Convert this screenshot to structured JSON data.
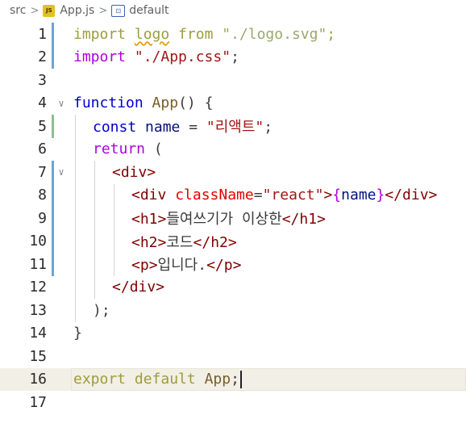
{
  "breadcrumb": {
    "folder": "src",
    "file": "App.js",
    "symbol": "default",
    "file_icon": "js-file-icon",
    "symbol_icon": "module-icon"
  },
  "editor": {
    "current_line": 16,
    "lines": [
      {
        "n": "1",
        "tokens": [
          [
            "import ",
            "faded"
          ],
          [
            "logo",
            "logo-faded squig"
          ],
          [
            " from ",
            "faded"
          ],
          [
            "\"./logo.svg\"",
            "faded-str"
          ],
          [
            ";",
            "faded"
          ]
        ],
        "mark": "#6fa3d6",
        "indent": 0
      },
      {
        "n": "2",
        "tokens": [
          [
            "import ",
            "kwc"
          ],
          [
            "\"./App.css\"",
            "str"
          ],
          [
            ";",
            "punc"
          ]
        ],
        "mark": "#6fa3d6",
        "indent": 0
      },
      {
        "n": "3",
        "tokens": [],
        "indent": 0
      },
      {
        "n": "4",
        "tokens": [
          [
            "function ",
            "kw"
          ],
          [
            "App",
            "fn"
          ],
          [
            "() {",
            "punc"
          ]
        ],
        "fold": "v",
        "indent": 0
      },
      {
        "n": "5",
        "tokens": [
          [
            "const ",
            "kw"
          ],
          [
            "name",
            "var"
          ],
          [
            " = ",
            "punc"
          ],
          [
            "\"리액트\"",
            "str"
          ],
          [
            ";",
            "punc"
          ]
        ],
        "mark": "#8dbf8d",
        "indent": 1
      },
      {
        "n": "6",
        "tokens": [
          [
            "return ",
            "kwc"
          ],
          [
            "(",
            "punc"
          ]
        ],
        "indent": 1
      },
      {
        "n": "7",
        "tokens": [
          [
            "<",
            "tag"
          ],
          [
            "div",
            "tagn"
          ],
          [
            ">",
            "tag"
          ]
        ],
        "fold": "v",
        "mark": "#6fa3d6",
        "indent": 2
      },
      {
        "n": "8",
        "tokens": [
          [
            "<",
            "tag"
          ],
          [
            "div ",
            "tagn"
          ],
          [
            "className",
            "attr"
          ],
          [
            "=",
            "punc"
          ],
          [
            "\"react\"",
            "str"
          ],
          [
            ">",
            "tag"
          ],
          [
            "{",
            "brace2"
          ],
          [
            "name",
            "var"
          ],
          [
            "}",
            "brace2"
          ],
          [
            "</",
            "tag"
          ],
          [
            "div",
            "tagn"
          ],
          [
            ">",
            "tag"
          ]
        ],
        "mark": "#6fa3d6",
        "indent": 3
      },
      {
        "n": "9",
        "tokens": [
          [
            "<",
            "tag"
          ],
          [
            "h1",
            "tagn"
          ],
          [
            ">",
            "tag"
          ],
          [
            "들여쓰기가 이상한",
            "punc"
          ],
          [
            "</",
            "tag"
          ],
          [
            "h1",
            "tagn"
          ],
          [
            ">",
            "tag"
          ]
        ],
        "mark": "#6fa3d6",
        "indent": 3
      },
      {
        "n": "10",
        "tokens": [
          [
            "<",
            "tag"
          ],
          [
            "h2",
            "tagn"
          ],
          [
            ">",
            "tag"
          ],
          [
            "코드",
            "punc"
          ],
          [
            "</",
            "tag"
          ],
          [
            "h2",
            "tagn"
          ],
          [
            ">",
            "tag"
          ]
        ],
        "mark": "#6fa3d6",
        "indent": 3
      },
      {
        "n": "11",
        "tokens": [
          [
            "<",
            "tag"
          ],
          [
            "p",
            "tagn"
          ],
          [
            ">",
            "tag"
          ],
          [
            "입니다.",
            "punc"
          ],
          [
            "</",
            "tag"
          ],
          [
            "p",
            "tagn"
          ],
          [
            ">",
            "tag"
          ]
        ],
        "mark": "#6fa3d6",
        "indent": 3
      },
      {
        "n": "12",
        "tokens": [
          [
            "</",
            "tag"
          ],
          [
            "div",
            "tagn"
          ],
          [
            ">",
            "tag"
          ]
        ],
        "indent": 2
      },
      {
        "n": "13",
        "tokens": [
          [
            ");",
            "punc"
          ]
        ],
        "indent": 1
      },
      {
        "n": "14",
        "tokens": [
          [
            "}",
            "punc"
          ]
        ],
        "indent": 0
      },
      {
        "n": "15",
        "tokens": [],
        "indent": 0
      },
      {
        "n": "16",
        "tokens": [
          [
            "export ",
            "faded"
          ],
          [
            "default ",
            "faded"
          ],
          [
            "App",
            "fn"
          ],
          [
            ";",
            "punc"
          ]
        ],
        "indent": 0,
        "cursor": true
      },
      {
        "n": "17",
        "tokens": [],
        "indent": 0
      }
    ]
  }
}
